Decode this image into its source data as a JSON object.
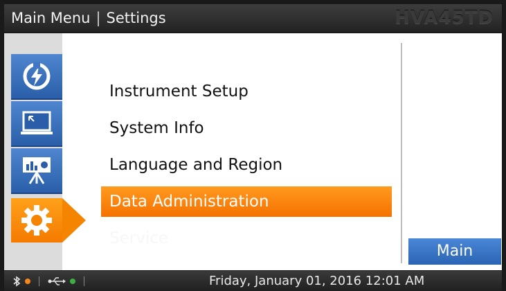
{
  "header": {
    "breadcrumb_main": "Main Menu",
    "breadcrumb_separator": "|",
    "breadcrumb_current": "Settings",
    "model": "HVA45TD"
  },
  "sidebar": {
    "items": [
      {
        "name": "power",
        "icon": "power-icon"
      },
      {
        "name": "display",
        "icon": "monitor-icon"
      },
      {
        "name": "presentation",
        "icon": "chart-board-icon"
      },
      {
        "name": "settings",
        "icon": "gear-icon",
        "active": true
      }
    ]
  },
  "menu": {
    "items": [
      {
        "label": "Instrument Setup"
      },
      {
        "label": "System Info"
      },
      {
        "label": "Language and Region"
      },
      {
        "label": "Data Administration",
        "selected": true
      },
      {
        "label": "Service",
        "faded": true
      }
    ]
  },
  "buttons": {
    "main_label": "Main"
  },
  "status_bar": {
    "bluetooth_icon": "bluetooth-icon",
    "bluetooth_status_color": "#f5871f",
    "usb_icon": "usb-icon",
    "usb_status_color": "#3cb043",
    "datetime": "Friday, January 01, 2016 12:01 AM"
  },
  "colors": {
    "accent_orange": "#f57c00",
    "nav_blue": "#3a6fbf",
    "header_bg": "#2e2e2e"
  }
}
